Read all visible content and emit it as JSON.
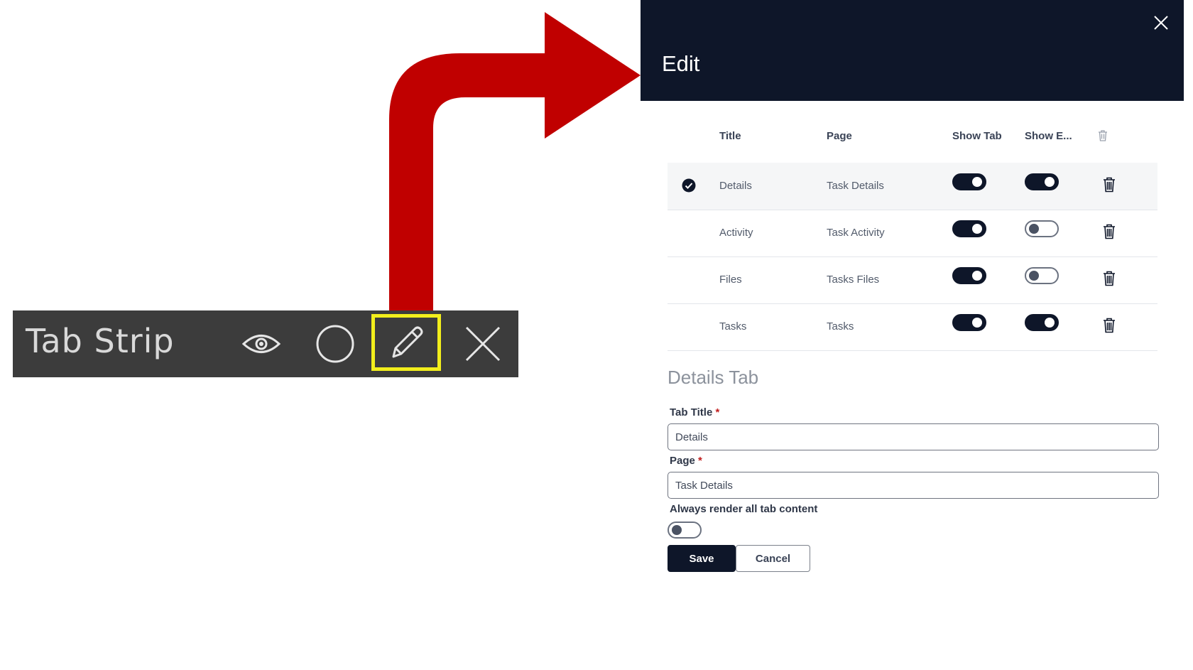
{
  "tabstrip": {
    "title": "Tab Strip",
    "icons": [
      "eye-icon",
      "circle-icon",
      "pencil-icon",
      "close-icon"
    ],
    "highlight_color": "#f2ee1c"
  },
  "arrow": {
    "color": "#c00000"
  },
  "panel": {
    "title": "Edit",
    "header_color": "#0e1629",
    "columns": {
      "title": "Title",
      "page": "Page",
      "show_tab": "Show Tab",
      "show_e": "Show E..."
    },
    "rows": [
      {
        "title": "Details",
        "page": "Task Details",
        "show_tab": true,
        "show_e": true,
        "selected": true
      },
      {
        "title": "Activity",
        "page": "Task Activity",
        "show_tab": true,
        "show_e": false,
        "selected": false
      },
      {
        "title": "Files",
        "page": "Tasks Files",
        "show_tab": true,
        "show_e": false,
        "selected": false
      },
      {
        "title": "Tasks",
        "page": "Tasks",
        "show_tab": true,
        "show_e": true,
        "selected": false
      }
    ],
    "section_title": "Details Tab",
    "tab_title_label": "Tab Title",
    "tab_title_value": "Details",
    "page_label": "Page",
    "page_value": "Task Details",
    "required_mark": "*",
    "always_render_label": "Always render all tab content",
    "always_render_on": false,
    "save_label": "Save",
    "cancel_label": "Cancel"
  }
}
